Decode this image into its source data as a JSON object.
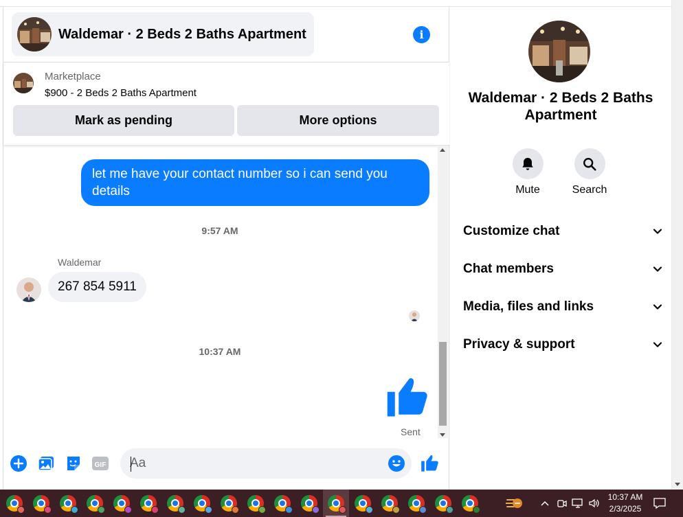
{
  "header": {
    "title": "Waldemar · 2 Beds 2 Baths Apartment"
  },
  "marketplace": {
    "label": "Marketplace",
    "listing": "$900 - 2 Beds 2 Baths Apartment",
    "mark_pending": "Mark as pending",
    "more_options": "More options"
  },
  "messages": {
    "outgoing_1": "let me have your contact number so i can send you details",
    "time_1": "9:57 AM",
    "sender": "Waldemar",
    "incoming_1": "267 854 5911",
    "time_2": "10:37 AM",
    "sent_status": "Sent"
  },
  "composer": {
    "placeholder": "Aa"
  },
  "sidebar": {
    "title": "Waldemar · 2 Beds 2 Baths Apartment",
    "actions": [
      {
        "label": "Mute",
        "icon": "bell-icon"
      },
      {
        "label": "Search",
        "icon": "search-icon"
      }
    ],
    "sections": [
      {
        "label": "Customize chat"
      },
      {
        "label": "Chat members"
      },
      {
        "label": "Media, files and links"
      },
      {
        "label": "Privacy & support"
      }
    ]
  },
  "taskbar": {
    "time": "10:37 AM",
    "date": "2/3/2025",
    "apps": [
      {
        "profile_color": "#e06a5a"
      },
      {
        "profile_color": "#e0487a"
      },
      {
        "profile_color": "#3fa9d8"
      },
      {
        "profile_color": "#4aa564"
      },
      {
        "profile_color": "#b44ac0"
      },
      {
        "profile_color": "#d93f6f"
      },
      {
        "profile_color": "#5fb3a0"
      },
      {
        "profile_color": "#5aa6e0"
      },
      {
        "profile_color": "#e07a3a"
      },
      {
        "profile_color": "#6cb04a"
      },
      {
        "profile_color": "#3a8fe0"
      },
      {
        "profile_color": "#8a6cd8"
      },
      {
        "profile_color": "#e05a5a"
      },
      {
        "profile_color": "#58b0d0"
      },
      {
        "profile_color": "#c0a040"
      },
      {
        "profile_color": "#5a8ad8"
      },
      {
        "profile_color": "#4aa0a0"
      },
      {
        "profile_color": "#2e7d32"
      }
    ]
  },
  "colors": {
    "accent": "#0a7cff",
    "bubble_in": "#f0f2f5",
    "taskbar": "#3b1f24"
  }
}
